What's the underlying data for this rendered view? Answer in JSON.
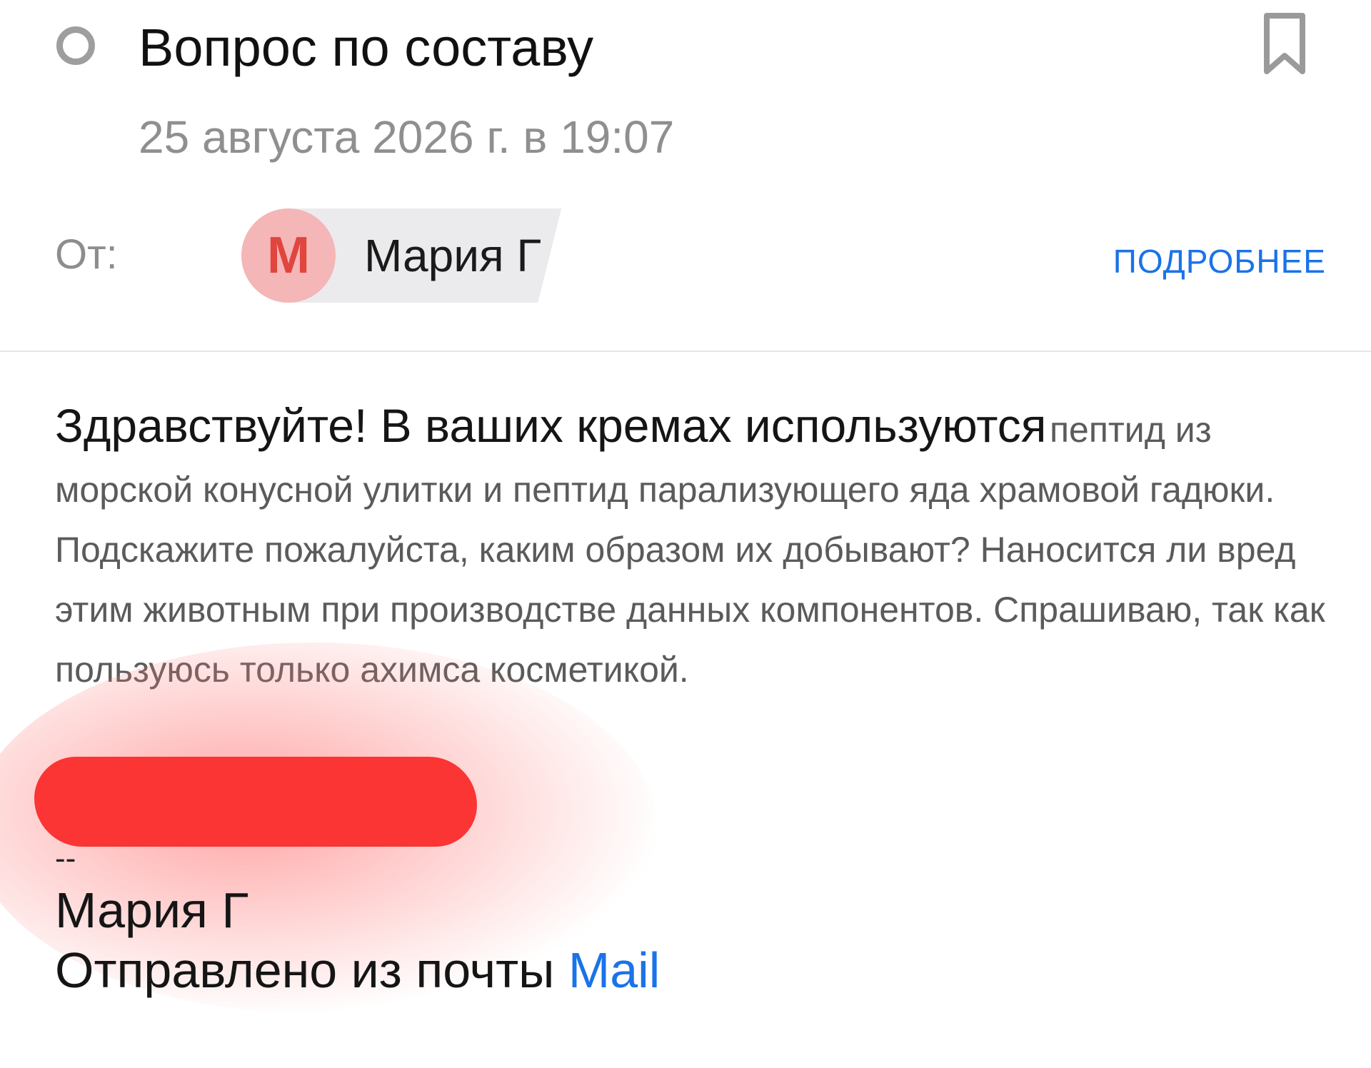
{
  "header": {
    "subject": "Вопрос по составу",
    "date": "25 августа 2026 г. в 19:07",
    "from_label": "От:",
    "sender": {
      "avatar_letter": "М",
      "name": "Мария Г"
    },
    "details_link": "ПОДРОБНЕЕ",
    "icons": {
      "status": "unread-circle-icon",
      "bookmark": "bookmark-icon"
    }
  },
  "message": {
    "greeting": "Здравствуйте! В ваших кремах используются",
    "text_tail": "пептид из морской конусной улитки и пептид парализующего яда храмовой гадюки. Подскажите пожалуйста, каким образом их добывают? Наносится ли вред этим животным при производстве данных компонентов. Спрашиваю, так как пользуюсь только ахимса косметикой."
  },
  "signature": {
    "dashes": "--",
    "name": "Мария Г",
    "sent_prefix": "Отправлено из почты",
    "sent_link": "Mail"
  },
  "colors": {
    "link": "#1a73e8",
    "avatar_bg": "#f4b6b6",
    "avatar_letter": "#e0453f",
    "redaction": "#fb3434",
    "muted_text": "#8f8f8f"
  }
}
